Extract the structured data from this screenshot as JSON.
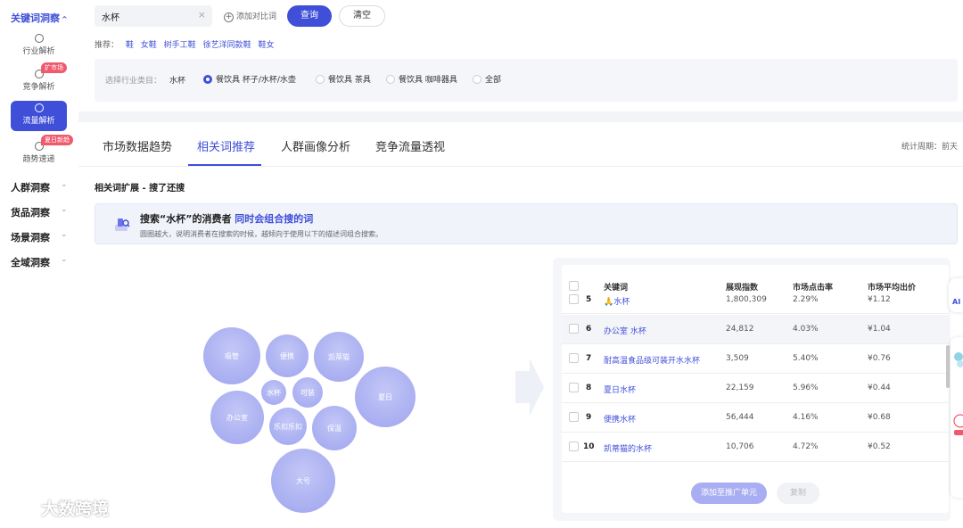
{
  "sidebar": {
    "section_title": "关键词洞察",
    "items": [
      {
        "label": "行业解析",
        "icon": "radar-icon"
      },
      {
        "label": "竞争解析",
        "badge": "扩市场",
        "icon": "radar-icon"
      },
      {
        "label": "流量解析",
        "icon": "radar-icon",
        "active": true
      },
      {
        "label": "趋势速递",
        "badge": "夏日新趋",
        "icon": "radar-icon"
      }
    ],
    "groups": [
      "人群洞察",
      "货品洞察",
      "场景洞察",
      "全域洞察"
    ]
  },
  "search": {
    "value": "水杯",
    "add_compare": "添加对比词",
    "query_label": "查询",
    "clear_label": "清空",
    "recommend_label": "推荐：",
    "recommend_words": [
      "鞋",
      "女鞋",
      "树手工鞋",
      "徐艺洋同款鞋",
      "鞋女"
    ]
  },
  "industry": {
    "label": "选择行业类目：",
    "value": "水杯",
    "options": [
      {
        "label": "餐饮具 杯子/水杯/水壶",
        "selected": true
      },
      {
        "label": "餐饮具 茶具",
        "selected": false
      },
      {
        "label": "餐饮具 咖啡器具",
        "selected": false
      },
      {
        "label": "全部",
        "selected": false
      }
    ]
  },
  "tabs": [
    {
      "label": "市场数据趋势",
      "active": false
    },
    {
      "label": "相关词推荐",
      "active": true
    },
    {
      "label": "人群画像分析",
      "active": false
    },
    {
      "label": "竞争流量透视",
      "active": false
    }
  ],
  "period": "统计周期：前天",
  "section_title": "相关词扩展 - 搜了还搜",
  "info": {
    "title_prefix": "搜索“水杯”的消费者 ",
    "title_highlight": "同时会组合搜的词",
    "desc": "圆圈越大，说明消费者在搜索的时候，越倾向于使用以下的描述词组合搜索。"
  },
  "bubbles": [
    "吸管",
    "便携",
    "凯蒂猫",
    "水杯",
    "可装",
    "夏日",
    "办公室",
    "乐扣乐扣",
    "保温",
    "大号"
  ],
  "table": {
    "headers": [
      "关键词",
      "展现指数",
      "市场点击率",
      "市场平均出价"
    ],
    "rows": [
      {
        "rank": "5",
        "keyword": "🙏水杯",
        "index": "1,800,309",
        "ctr": "2.29%",
        "bid": "¥1.12"
      },
      {
        "rank": "6",
        "keyword": "办公室 水杯",
        "index": "24,812",
        "ctr": "4.03%",
        "bid": "¥1.04"
      },
      {
        "rank": "7",
        "keyword": "耐高温食品级可装开水水杯",
        "index": "3,509",
        "ctr": "5.40%",
        "bid": "¥0.76"
      },
      {
        "rank": "8",
        "keyword": "夏日水杯",
        "index": "22,159",
        "ctr": "5.96%",
        "bid": "¥0.44"
      },
      {
        "rank": "9",
        "keyword": "便携水杯",
        "index": "56,444",
        "ctr": "4.16%",
        "bid": "¥0.68"
      },
      {
        "rank": "10",
        "keyword": "凯蒂猫的水杯",
        "index": "10,706",
        "ctr": "4.72%",
        "bid": "¥0.52"
      }
    ],
    "add_button": "添加至推广单元",
    "copy_button": "复制"
  },
  "ai_widget": {
    "label": "AI"
  },
  "watermark": "大数跨境"
}
